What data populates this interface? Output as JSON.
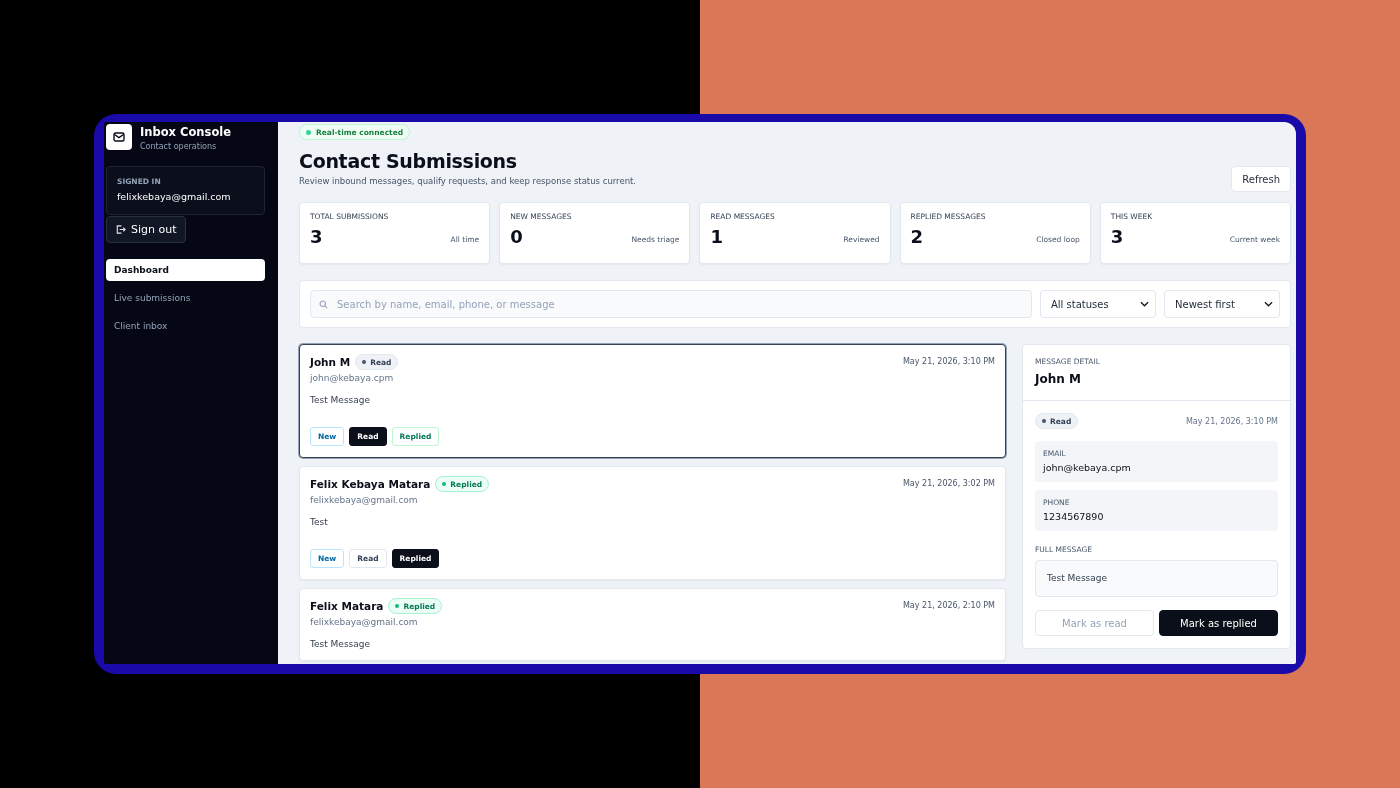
{
  "sidebar": {
    "brand": {
      "title": "Inbox Console",
      "subtitle": "Contact operations"
    },
    "account": {
      "label": "SIGNED IN",
      "email": "felixkebaya@gmail.com"
    },
    "sign_out": "Sign out",
    "items": [
      {
        "label": "Dashboard",
        "selected": true
      },
      {
        "label": "Live submissions",
        "selected": false
      },
      {
        "label": "Client inbox",
        "selected": false
      }
    ]
  },
  "connection": {
    "label": "Real-time connected",
    "on": true
  },
  "header": {
    "title": "Contact Submissions",
    "subtitle": "Review inbound messages, qualify requests, and keep response status current.",
    "refresh": "Refresh"
  },
  "stats": [
    {
      "label": "TOTAL SUBMISSIONS",
      "value": "3",
      "note": "All time"
    },
    {
      "label": "NEW MESSAGES",
      "value": "0",
      "note": "Needs triage"
    },
    {
      "label": "READ MESSAGES",
      "value": "1",
      "note": "Reviewed"
    },
    {
      "label": "REPLIED MESSAGES",
      "value": "2",
      "note": "Closed loop"
    },
    {
      "label": "THIS WEEK",
      "value": "3",
      "note": "Current week"
    }
  ],
  "filters": {
    "search": {
      "placeholder": "Search by name, email, phone, or message"
    },
    "status": "All statuses",
    "sort": "Newest first"
  },
  "submissions": [
    {
      "name": "John M",
      "status": {
        "label": "Read",
        "kind": "read"
      },
      "email": "john@kebaya.cpm",
      "message": "Test Message",
      "time": "May 21, 2026, 3:10 PM",
      "selected": true,
      "actions": [
        {
          "label": "New",
          "kind": "new",
          "selected": false
        },
        {
          "label": "Read",
          "kind": "read",
          "selected": true
        },
        {
          "label": "Replied",
          "kind": "replied",
          "selected": false
        }
      ]
    },
    {
      "name": "Felix Kebaya Matara",
      "status": {
        "label": "Replied",
        "kind": "replied"
      },
      "email": "felixkebaya@gmail.com",
      "message": "Test",
      "time": "May 21, 2026, 3:02 PM",
      "selected": false,
      "actions": [
        {
          "label": "New",
          "kind": "new",
          "selected": false
        },
        {
          "label": "Read",
          "kind": "read",
          "selected": false
        },
        {
          "label": "Replied",
          "kind": "replied",
          "selected": true
        }
      ]
    },
    {
      "name": "Felix Matara",
      "status": {
        "label": "Replied",
        "kind": "replied"
      },
      "email": "felixkebaya@gmail.com",
      "message": "Test Message",
      "time": "May 21, 2026, 2:10 PM",
      "selected": false
    }
  ],
  "detail": {
    "label": "MESSAGE DETAIL",
    "name": "John M",
    "status": {
      "label": "Read",
      "kind": "read"
    },
    "time": "May 21, 2026, 3:10 PM",
    "fields": [
      {
        "label": "EMAIL",
        "value": "john@kebaya.cpm"
      },
      {
        "label": "PHONE",
        "value": "1234567890"
      }
    ],
    "message_label": "FULL MESSAGE",
    "message": "Test Message",
    "actions": [
      {
        "label": "Mark as read",
        "disabled": true
      },
      {
        "label": "Mark as replied",
        "disabled": false
      }
    ]
  }
}
